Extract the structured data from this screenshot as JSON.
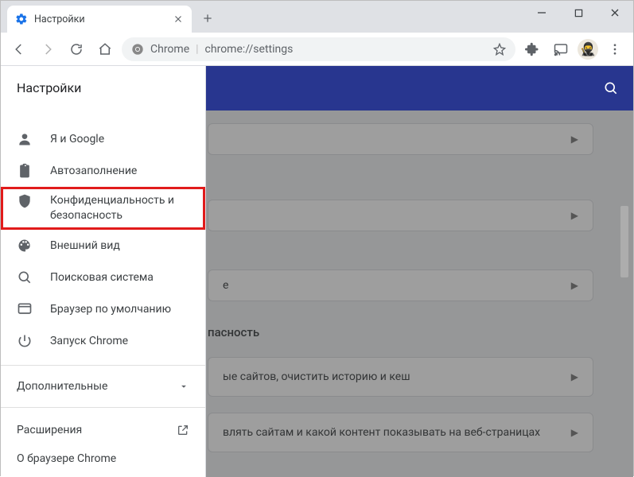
{
  "window": {
    "tab_title": "Настройки",
    "newtab_tooltip": "Новая вкладка"
  },
  "toolbar": {
    "chrome_label": "Chrome",
    "url": "chrome://settings"
  },
  "sidebar": {
    "title": "Настройки",
    "items": [
      {
        "id": "you-and-google",
        "label": "Я и Google",
        "icon": "person-icon"
      },
      {
        "id": "autofill",
        "label": "Автозаполнение",
        "icon": "clipboard-icon"
      },
      {
        "id": "privacy",
        "label": "Конфиденциальность и безопасность",
        "icon": "shield-icon",
        "highlight": true
      },
      {
        "id": "appearance",
        "label": "Внешний вид",
        "icon": "palette-icon"
      },
      {
        "id": "search",
        "label": "Поисковая система",
        "icon": "search-icon"
      },
      {
        "id": "default-browser",
        "label": "Браузер по умолчанию",
        "icon": "browser-icon"
      },
      {
        "id": "startup",
        "label": "Запуск Chrome",
        "icon": "power-icon"
      }
    ],
    "advanced_label": "Дополнительные",
    "extensions_label": "Расширения",
    "about_label": "О браузере Chrome"
  },
  "main": {
    "section_title_fragment": "пасность",
    "card1_text": "е",
    "card2_text": "ые сайтов, очистить историю и кеш",
    "card3_text": "влять сайтам и какой контент показывать на веб-страницах"
  }
}
